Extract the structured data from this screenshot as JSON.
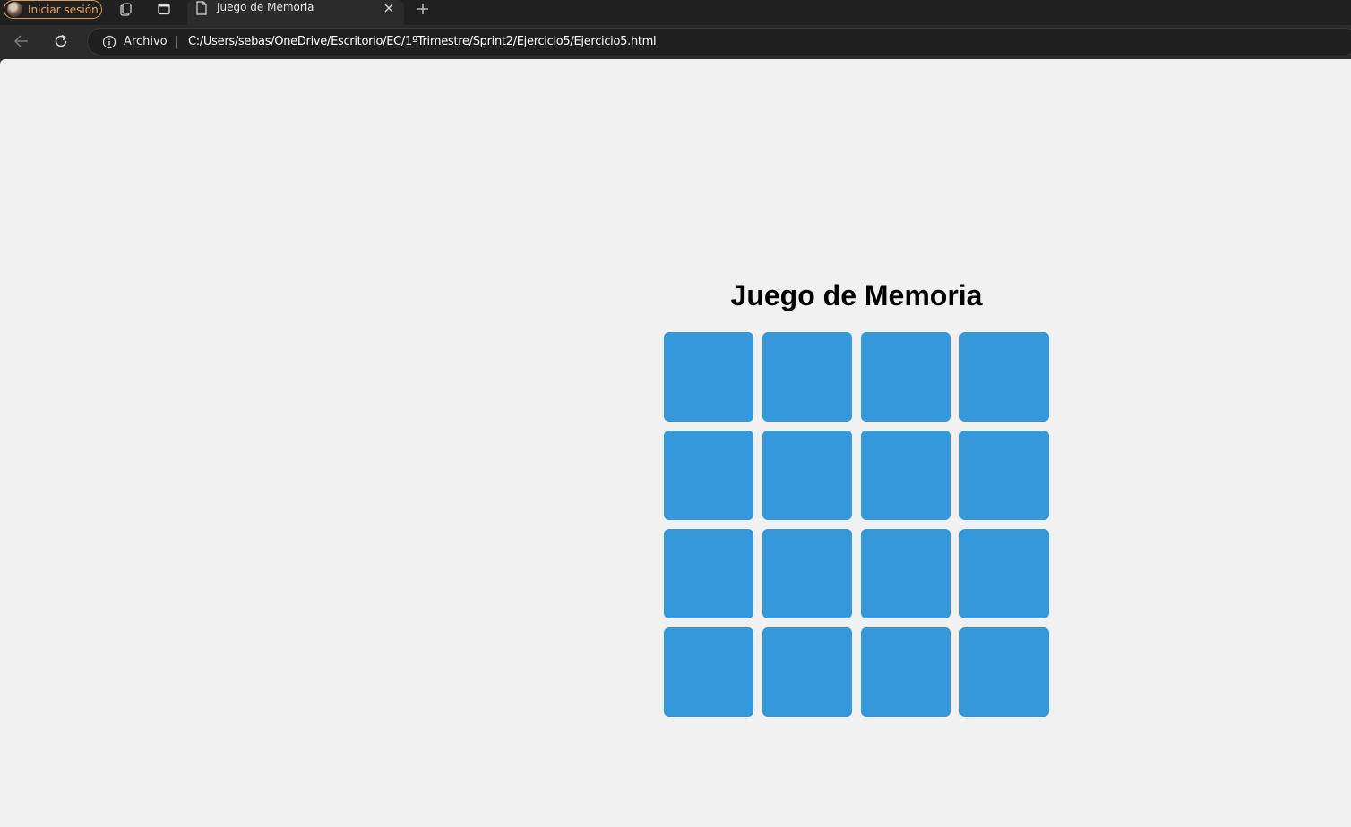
{
  "browser": {
    "profile_label": "Iniciar sesión",
    "tab_title": "Juego de Memoria",
    "address": {
      "scheme_label": "Archivo",
      "url": "C:/Users/sebas/OneDrive/Escritorio/EC/1ºTrimestre/Sprint2/Ejercicio5/Ejercicio5.html"
    },
    "icons": {
      "profile": "avatar",
      "workspaces": "workspaces-icon",
      "tab_actions": "tab-actions-icon",
      "tab_page": "page-icon",
      "close": "close-icon",
      "new_tab": "plus-icon",
      "back": "back-arrow-icon",
      "reload": "reload-icon",
      "info": "info-icon"
    }
  },
  "page": {
    "title": "Juego de Memoria",
    "card_color": "#3498db",
    "background": "#f1f1f1",
    "cards": [
      {
        "state": "face-down"
      },
      {
        "state": "face-down"
      },
      {
        "state": "face-down"
      },
      {
        "state": "face-down"
      },
      {
        "state": "face-down"
      },
      {
        "state": "face-down"
      },
      {
        "state": "face-down"
      },
      {
        "state": "face-down"
      },
      {
        "state": "face-down"
      },
      {
        "state": "face-down"
      },
      {
        "state": "face-down"
      },
      {
        "state": "face-down"
      },
      {
        "state": "face-down"
      },
      {
        "state": "face-down"
      },
      {
        "state": "face-down"
      },
      {
        "state": "face-down"
      }
    ]
  }
}
